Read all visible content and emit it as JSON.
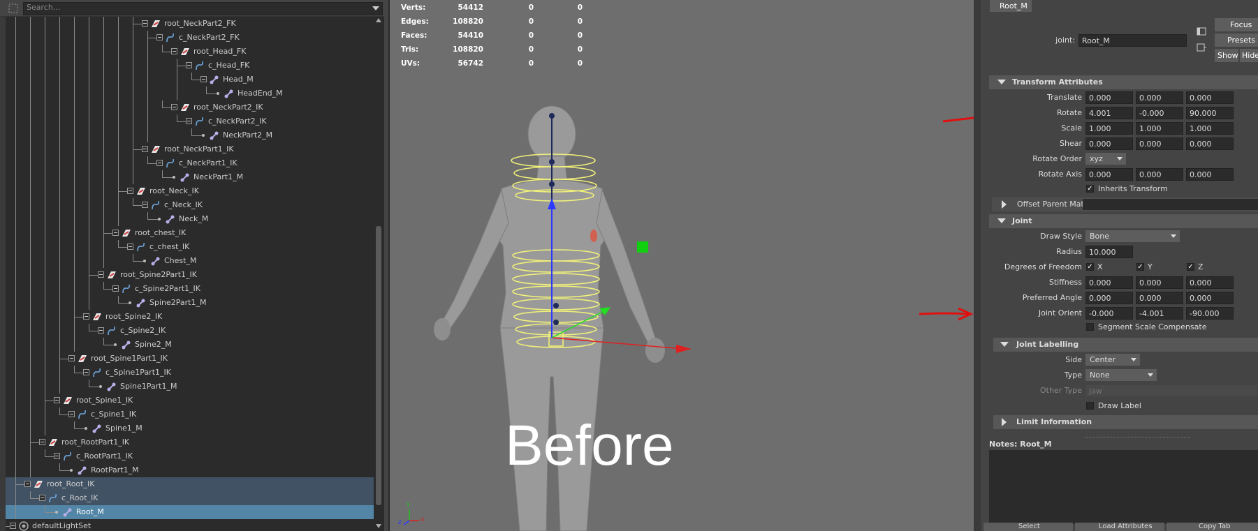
{
  "outliner": {
    "search_placeholder": "Search...",
    "items": [
      {
        "label": "root_NeckPart2_FK",
        "depth": 10,
        "kind": "root"
      },
      {
        "label": "c_NeckPart2_FK",
        "depth": 11,
        "kind": "curve"
      },
      {
        "label": "root_Head_FK",
        "depth": 12,
        "kind": "root"
      },
      {
        "label": "c_Head_FK",
        "depth": 13,
        "kind": "curve"
      },
      {
        "label": "Head_M",
        "depth": 14,
        "kind": "joint"
      },
      {
        "label": "HeadEnd_M",
        "depth": 15,
        "kind": "joint",
        "leaf": true
      },
      {
        "label": "root_NeckPart2_IK",
        "depth": 12,
        "kind": "root"
      },
      {
        "label": "c_NeckPart2_IK",
        "depth": 13,
        "kind": "curve"
      },
      {
        "label": "NeckPart2_M",
        "depth": 14,
        "kind": "joint",
        "leaf": true
      },
      {
        "label": "root_NeckPart1_IK",
        "depth": 10,
        "kind": "root"
      },
      {
        "label": "c_NeckPart1_IK",
        "depth": 11,
        "kind": "curve"
      },
      {
        "label": "NeckPart1_M",
        "depth": 12,
        "kind": "joint",
        "leaf": true
      },
      {
        "label": "root_Neck_IK",
        "depth": 9,
        "kind": "root"
      },
      {
        "label": "c_Neck_IK",
        "depth": 10,
        "kind": "curve"
      },
      {
        "label": "Neck_M",
        "depth": 11,
        "kind": "joint",
        "leaf": true
      },
      {
        "label": "root_chest_IK",
        "depth": 8,
        "kind": "root"
      },
      {
        "label": "c_chest_IK",
        "depth": 9,
        "kind": "curve"
      },
      {
        "label": "Chest_M",
        "depth": 10,
        "kind": "joint",
        "leaf": true
      },
      {
        "label": "root_Spine2Part1_IK",
        "depth": 7,
        "kind": "root"
      },
      {
        "label": "c_Spine2Part1_IK",
        "depth": 8,
        "kind": "curve"
      },
      {
        "label": "Spine2Part1_M",
        "depth": 9,
        "kind": "joint",
        "leaf": true
      },
      {
        "label": "root_Spine2_IK",
        "depth": 6,
        "kind": "root"
      },
      {
        "label": "c_Spine2_IK",
        "depth": 7,
        "kind": "curve"
      },
      {
        "label": "Spine2_M",
        "depth": 8,
        "kind": "joint",
        "leaf": true
      },
      {
        "label": "root_Spine1Part1_IK",
        "depth": 5,
        "kind": "root"
      },
      {
        "label": "c_Spine1Part1_IK",
        "depth": 6,
        "kind": "curve"
      },
      {
        "label": "Spine1Part1_M",
        "depth": 7,
        "kind": "joint",
        "leaf": true
      },
      {
        "label": "root_Spine1_IK",
        "depth": 4,
        "kind": "root"
      },
      {
        "label": "c_Spine1_IK",
        "depth": 5,
        "kind": "curve"
      },
      {
        "label": "Spine1_M",
        "depth": 6,
        "kind": "joint",
        "leaf": true
      },
      {
        "label": "root_RootPart1_IK",
        "depth": 3,
        "kind": "root"
      },
      {
        "label": "c_RootPart1_IK",
        "depth": 4,
        "kind": "curve"
      },
      {
        "label": "RootPart1_M",
        "depth": 5,
        "kind": "joint",
        "leaf": true
      },
      {
        "label": "root_Root_IK",
        "depth": 2,
        "kind": "root",
        "state": "sel-parent"
      },
      {
        "label": "c_Root_IK",
        "depth": 3,
        "kind": "curve",
        "state": "sel-parent"
      },
      {
        "label": "Root_M",
        "depth": 4,
        "kind": "joint",
        "leaf": true,
        "state": "sel"
      },
      {
        "label": "defaultLightSet",
        "depth": 1,
        "kind": "set"
      }
    ]
  },
  "viewport": {
    "hud": [
      {
        "name": "Verts:",
        "v1": "54412",
        "v2": "0",
        "v3": "0"
      },
      {
        "name": "Edges:",
        "v1": "108820",
        "v2": "0",
        "v3": "0"
      },
      {
        "name": "Faces:",
        "v1": "54410",
        "v2": "0",
        "v3": "0"
      },
      {
        "name": "Tris:",
        "v1": "108820",
        "v2": "0",
        "v3": "0"
      },
      {
        "name": "UVs:",
        "v1": "56742",
        "v2": "0",
        "v3": "0"
      }
    ],
    "overlay_text": "Before",
    "axis_labels": {
      "x": "x",
      "y": "y",
      "z": "z"
    }
  },
  "attribute_editor": {
    "tab": "Root_M",
    "node_label": "joint:",
    "node_name": "Root_M",
    "buttons": {
      "focus": "Focus",
      "presets": "Presets",
      "show": "Show",
      "hide": "Hide"
    },
    "sections": {
      "transform": "Transform Attributes",
      "offset_parent": "Offset Parent Matrix",
      "joint": "Joint",
      "joint_labelling": "Joint Labelling",
      "limit_info": "Limit Information"
    },
    "transform": {
      "translate_label": "Translate",
      "translate": [
        "0.000",
        "0.000",
        "0.000"
      ],
      "rotate_label": "Rotate",
      "rotate": [
        "4.001",
        "-0.000",
        "90.000"
      ],
      "scale_label": "Scale",
      "scale": [
        "1.000",
        "1.000",
        "1.000"
      ],
      "shear_label": "Shear",
      "shear": [
        "0.000",
        "0.000",
        "0.000"
      ],
      "rotate_order_label": "Rotate Order",
      "rotate_order": "xyz",
      "rotate_axis_label": "Rotate Axis",
      "rotate_axis": [
        "0.000",
        "0.000",
        "0.000"
      ],
      "inherits_transform": "Inherits Transform"
    },
    "joint": {
      "draw_style_label": "Draw Style",
      "draw_style": "Bone",
      "radius_label": "Radius",
      "radius": "10.000",
      "dof_label": "Degrees of Freedom",
      "dof": [
        "X",
        "Y",
        "Z"
      ],
      "stiffness_label": "Stiffness",
      "stiffness": [
        "0.000",
        "0.000",
        "0.000"
      ],
      "preferred_angle_label": "Preferred Angle",
      "preferred_angle": [
        "0.000",
        "0.000",
        "0.000"
      ],
      "joint_orient_label": "Joint Orient",
      "joint_orient": [
        "-0.000",
        "-4.001",
        "-90.000"
      ],
      "segment_scale": "Segment Scale Compensate"
    },
    "labelling": {
      "side_label": "Side",
      "side": "Center",
      "type_label": "Type",
      "type": "None",
      "other_type_label": "Other Type",
      "other_type": "jaw",
      "draw_label": "Draw Label"
    },
    "notes_label": "Notes:  Root_M",
    "bottom_buttons": [
      "Select",
      "Load Attributes",
      "Copy Tab"
    ]
  },
  "colors": {
    "selection": "#5285a6",
    "annotation_arrow": "#e01010",
    "rig_curves": "#f0f07a"
  }
}
